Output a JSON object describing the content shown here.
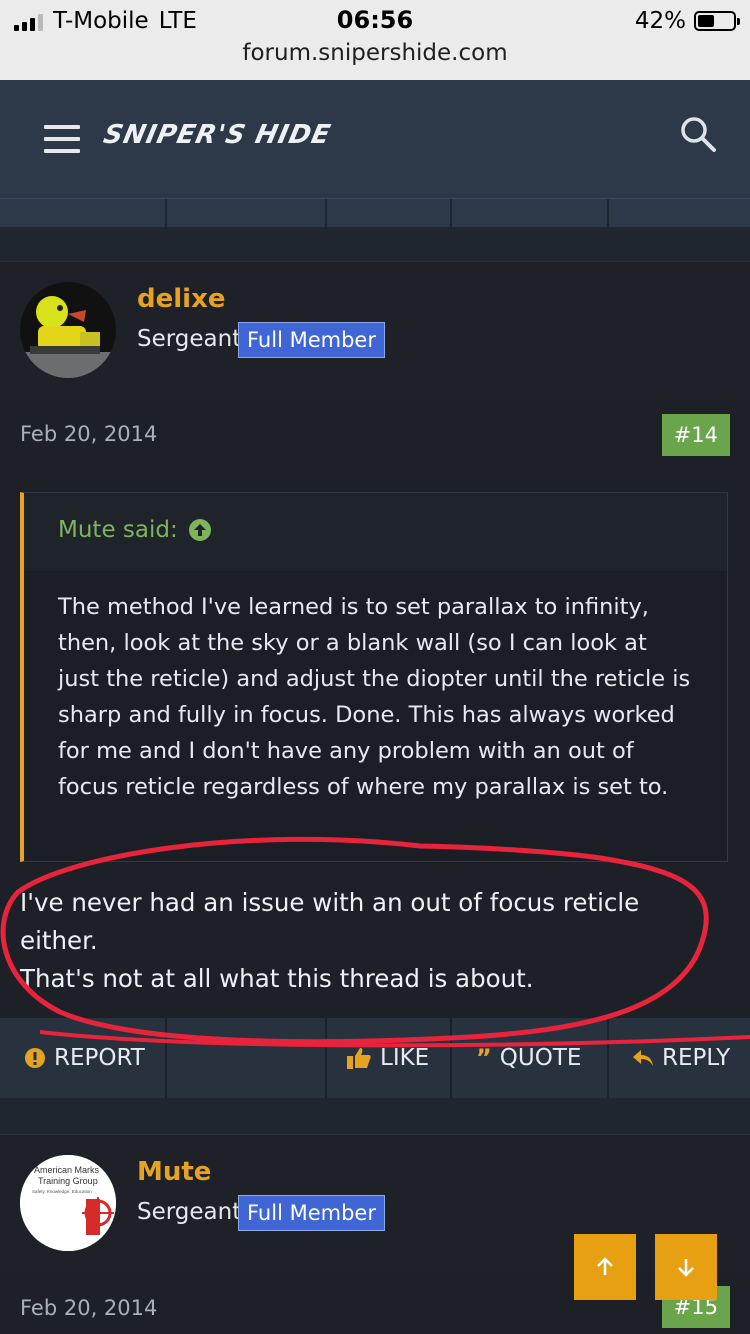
{
  "status_bar": {
    "carrier": "T-Mobile",
    "network": "LTE",
    "time": "06:56",
    "battery": "42%",
    "url": "forum.snipershide.com"
  },
  "header": {
    "logo": "SNIPER'S HIDE",
    "menu_icon": "hamburger-menu-icon",
    "search_icon": "search-icon"
  },
  "post1": {
    "username": "delixe",
    "rank": "Sergeant",
    "badge": "Full Member",
    "date": "Feb 20, 2014",
    "number": "#14",
    "quote": {
      "author": "Mute said:",
      "text": "The method I've learned is to set parallax to infinity, then, look at the sky or a blank wall (so I can look at just the reticle) and adjust the diopter until the reticle is sharp and fully in focus. Done. This has always worked for me and I don't have any problem with an out of focus reticle regardless of where my parallax is set to."
    },
    "text_line1": "I've never had an issue with an out of focus reticle either.",
    "text_line2": "That's not at all what this thread is about."
  },
  "actions": {
    "report": "REPORT",
    "like": "LIKE",
    "quote": "QUOTE",
    "reply": "REPLY"
  },
  "post2": {
    "username": "Mute",
    "rank": "Sergeant",
    "badge": "Full Member",
    "date": "Feb 20, 2014",
    "number": "#15",
    "avatar_text": {
      "line1": "American Marks",
      "line2": "Training Group",
      "line3": "Safety. Knowledge. Education"
    }
  },
  "colors": {
    "accent": "#e6a222",
    "header_bg": "#2d3849",
    "badge_bg": "#3f66d4",
    "post_number_bg": "#6aa44b",
    "annotation": "#e8243c"
  }
}
